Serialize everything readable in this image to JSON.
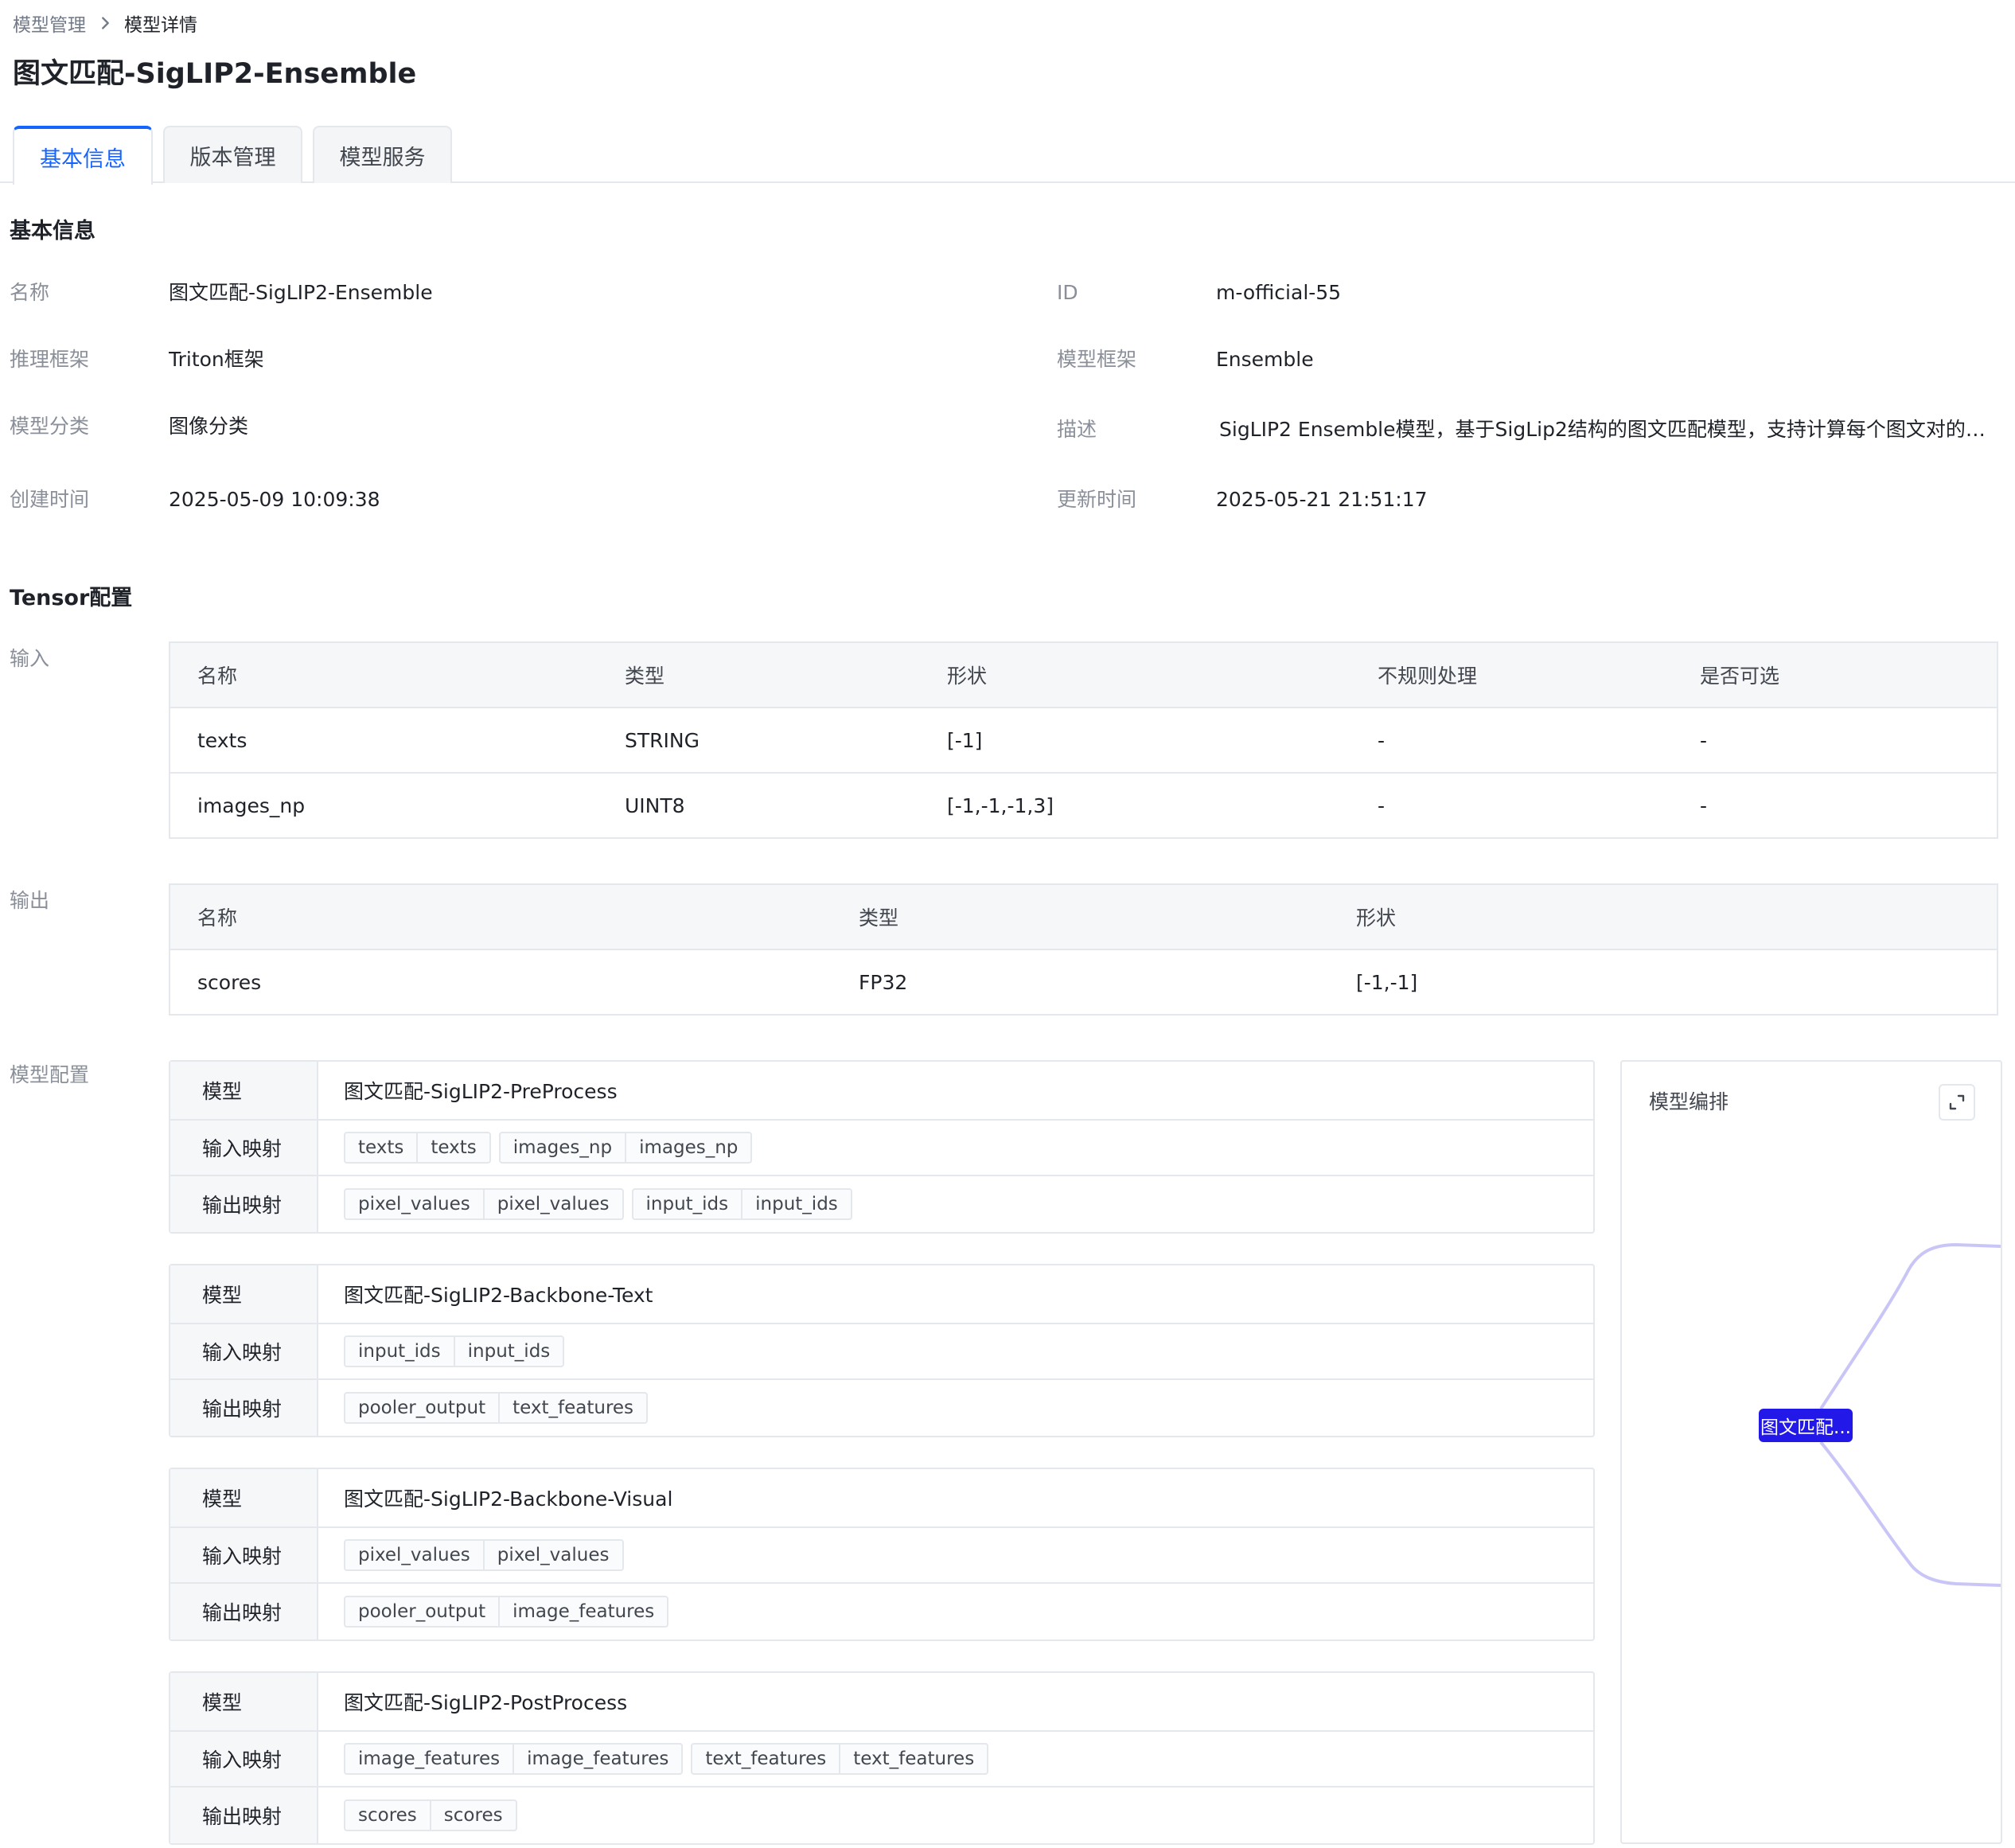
{
  "breadcrumb": {
    "parent": "模型管理",
    "current": "模型详情"
  },
  "page_title": "图文匹配-SigLIP2-Ensemble",
  "tabs": [
    {
      "label": "基本信息",
      "active": true
    },
    {
      "label": "版本管理",
      "active": false
    },
    {
      "label": "模型服务",
      "active": false
    }
  ],
  "basic_info": {
    "title": "基本信息",
    "fields": {
      "name_label": "名称",
      "name_value": "图文匹配-SigLIP2-Ensemble",
      "id_label": "ID",
      "id_value": "m-official-55",
      "infer_framework_label": "推理框架",
      "infer_framework_value": "Triton框架",
      "model_framework_label": "模型框架",
      "model_framework_value": "Ensemble",
      "category_label": "模型分类",
      "category_value": "图像分类",
      "desc_label": "描述",
      "desc_value": "SigLIP2 Ensemble模型，基于SigLip2结构的图文匹配模型，支持计算每个图文对的…",
      "created_label": "创建时间",
      "created_value": "2025-05-09 10:09:38",
      "updated_label": "更新时间",
      "updated_value": "2025-05-21 21:51:17"
    }
  },
  "tensor": {
    "title": "Tensor配置",
    "input_label": "输入",
    "input_headers": [
      "名称",
      "类型",
      "形状",
      "不规则处理",
      "是否可选"
    ],
    "input_rows": [
      [
        "texts",
        "STRING",
        "[-1]",
        "-",
        "-"
      ],
      [
        "images_np",
        "UINT8",
        "[-1,-1,-1,3]",
        "-",
        "-"
      ]
    ],
    "output_label": "输出",
    "output_headers": [
      "名称",
      "类型",
      "形状"
    ],
    "output_rows": [
      [
        "scores",
        "FP32",
        "[-1,-1]"
      ]
    ]
  },
  "model_config": {
    "label": "模型配置",
    "model_key": "模型",
    "input_map_key": "输入映射",
    "output_map_key": "输出映射",
    "steps": [
      {
        "model": "图文匹配-SigLIP2-PreProcess",
        "inputs": [
          [
            "texts",
            "texts"
          ],
          [
            "images_np",
            "images_np"
          ]
        ],
        "outputs": [
          [
            "pixel_values",
            "pixel_values"
          ],
          [
            "input_ids",
            "input_ids"
          ]
        ]
      },
      {
        "model": "图文匹配-SigLIP2-Backbone-Text",
        "inputs": [
          [
            "input_ids",
            "input_ids"
          ]
        ],
        "outputs": [
          [
            "pooler_output",
            "text_features"
          ]
        ]
      },
      {
        "model": "图文匹配-SigLIP2-Backbone-Visual",
        "inputs": [
          [
            "pixel_values",
            "pixel_values"
          ]
        ],
        "outputs": [
          [
            "pooler_output",
            "image_features"
          ]
        ]
      },
      {
        "model": "图文匹配-SigLIP2-PostProcess",
        "inputs": [
          [
            "image_features",
            "image_features"
          ],
          [
            "text_features",
            "text_features"
          ]
        ],
        "outputs": [
          [
            "scores",
            "scores"
          ]
        ]
      }
    ]
  },
  "orchestration": {
    "title": "模型编排",
    "node_label": "图文匹配...",
    "edge_color": "#c9c6f7",
    "node_color": "#2219e8"
  },
  "colors": {
    "primary": "#1664ff",
    "text": "#1f2329",
    "label": "#8a8f99",
    "border": "#e4e7ec"
  }
}
